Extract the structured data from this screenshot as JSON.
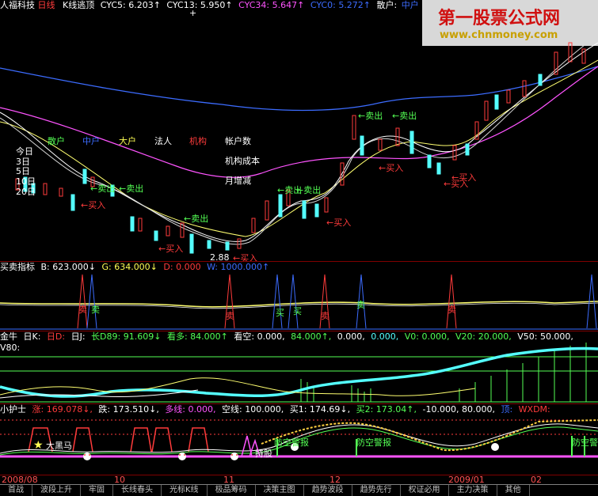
{
  "main": {
    "stock": "人福科技",
    "period": "日线",
    "title": "K线逃顶",
    "ma": [
      {
        "label": "CYC5: 6.203↑",
        "color": "#ffffff"
      },
      {
        "label": "CYC13: 5.950↑",
        "color": "#ffffff"
      },
      {
        "label": "CYC34: 5.647↑",
        "color": "#ff54ff"
      },
      {
        "label": "CYC0: 5.272↑",
        "color": "#3c6cff"
      },
      {
        "label": "散户:",
        "color": "#ffffff"
      },
      {
        "label": "中户",
        "color": "#3c6cff"
      }
    ],
    "legend": {
      "sanhu": "散户",
      "zhonghu": "中户",
      "dahu": "大户",
      "faren": "法人",
      "jigou": "机构",
      "zhanghu": "帐户数",
      "jigou_cost": "机构成本",
      "yue_zengjian": "月增减"
    },
    "periods": [
      "今日",
      "3日",
      "5日",
      "10日",
      "20日"
    ],
    "sell_label": "卖出",
    "buy_label": "买入",
    "low_price": "2.88"
  },
  "maimai": {
    "title": "买卖指标",
    "b": "B: 623.000↓",
    "g": "G: 634.000↓",
    "d": "D: 0.000",
    "w": "W: 1000.000↑",
    "mai": "卖",
    "mai2": "买"
  },
  "jinniu": {
    "title": "金牛",
    "period": "日K:",
    "ri_d": "日D:",
    "ri_j": "日J:",
    "items": [
      {
        "label": "长D89: 91.609↓",
        "color": "#54ff54"
      },
      {
        "label": "看多: 84.000↑",
        "color": "#54ff54"
      },
      {
        "label": "看空: 0.000,",
        "color": "#ffffff"
      },
      {
        "label": "84.000↑,",
        "color": "#54ff54"
      },
      {
        "label": "0.000,",
        "color": "#ffffff"
      },
      {
        "label": "0.000,",
        "color": "#54ffff"
      },
      {
        "label": "V0: 0.000,",
        "color": "#54ff54"
      },
      {
        "label": "V20: 20.000,",
        "color": "#54ff54"
      },
      {
        "label": "V50: 50.000,",
        "color": "#ffffff"
      },
      {
        "label": "V80:",
        "color": "#ffffff"
      }
    ]
  },
  "huzhu": {
    "title": "小护士",
    "items": [
      {
        "label": "涨: 169.078↓,",
        "color": "#ff3b3b"
      },
      {
        "label": "跌: 173.510↓,",
        "color": "#ffffff"
      },
      {
        "label": "多线: 0.000,",
        "color": "#ff54ff"
      },
      {
        "label": "空线: 100.000,",
        "color": "#ffffff"
      },
      {
        "label": "买1: 174.69↓,",
        "color": "#ffffff"
      },
      {
        "label": "买2: 173.04↑,",
        "color": "#54ff54"
      },
      {
        "label": "-10.000, 80.000,",
        "color": "#ffffff"
      },
      {
        "label": "顶:",
        "color": "#3c6cff"
      },
      {
        "label": "WXDM:",
        "color": "#ff3b3b"
      }
    ],
    "dahema": "大黑马",
    "fangkong": "防空警报",
    "fangkong2": "防空警",
    "jiezhu": "持股"
  },
  "dates": [
    "2008/08",
    "10",
    "11",
    "12",
    "2009/01",
    "02"
  ],
  "tabs": [
    "首战",
    "波段上升",
    "牢固",
    "长线春头",
    "光标K线",
    "极品筹码",
    "决策主图",
    "趋势波段",
    "趋势先行",
    "权证必用",
    "主力决策",
    "其他"
  ],
  "logo": {
    "line1": "第一股票公式网",
    "line2": "www.chnmoney.com"
  }
}
